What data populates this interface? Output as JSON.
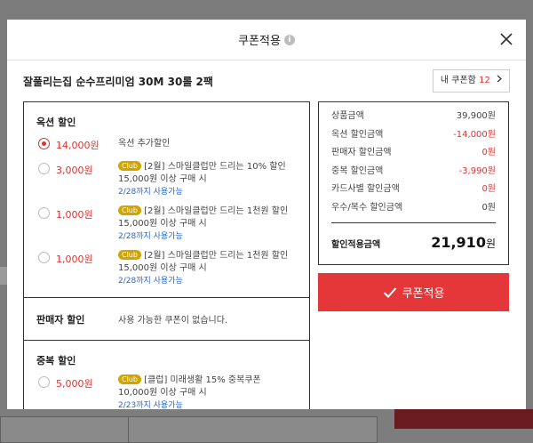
{
  "modal": {
    "title": "쿠폰적용",
    "info_icon": "info-icon",
    "close_icon": "close-icon"
  },
  "product": {
    "name": "잘풀리는집 순수프리미엄 30M 30롤 2팩",
    "my_coupons_label": "내 쿠폰함",
    "my_coupons_count": "12"
  },
  "auction_discount": {
    "title": "옥션 할인",
    "options": [
      {
        "amount": "14,000원",
        "selected": true,
        "desc": "옥션 추가할인",
        "sub": "",
        "date": ""
      },
      {
        "amount": "3,000원",
        "selected": false,
        "club": "Club",
        "desc": "[2월] 스마일클럽만 드리는 10% 할인",
        "sub": "15,000원 이상 구매 시",
        "date": "2/28까지 사용가능"
      },
      {
        "amount": "1,000원",
        "selected": false,
        "club": "Club",
        "desc": "[2월] 스마일클럽만 드리는 1천원 할인",
        "sub": "15,000원 이상 구매 시",
        "date": "2/28까지 사용가능"
      },
      {
        "amount": "1,000원",
        "selected": false,
        "club": "Club",
        "desc": "[2월] 스마일클럽만 드리는 1천원 할인",
        "sub": "15,000원 이상 구매 시",
        "date": "2/28까지 사용가능"
      }
    ]
  },
  "seller_discount": {
    "title": "판매자 할인",
    "text": "사용 가능한 쿠폰이 없습니다."
  },
  "duplicate_discount": {
    "title": "중복 할인",
    "options": [
      {
        "amount": "5,000원",
        "selected": false,
        "club": "Club",
        "desc": "[클럽] 미래생활 15% 중복쿠폰",
        "sub": "10,000원 이상 구매 시",
        "date": "2/23까지 사용가능"
      }
    ]
  },
  "summary": {
    "rows": [
      {
        "label": "상품금액",
        "value": "39,900원",
        "red": false
      },
      {
        "label": "옥션 할인금액",
        "value": "-14,000원",
        "red": true
      },
      {
        "label": "판매자 할인금액",
        "value": "0원",
        "red": true
      },
      {
        "label": "중복 할인금액",
        "value": "-3,990원",
        "red": true
      },
      {
        "label": "카드사별 할인금액",
        "value": "0원",
        "red": true
      },
      {
        "label": "우수/복수 할인금액",
        "value": "0원",
        "red": false
      }
    ],
    "total_label": "할인적용금액",
    "total_value": "21,910",
    "total_unit": "원"
  },
  "apply_button": {
    "label": "쿠폰적용",
    "icon": "check-icon"
  },
  "colors": {
    "accent": "#e5363a",
    "link": "#2a66c9",
    "club_badge": "#d2a400"
  }
}
